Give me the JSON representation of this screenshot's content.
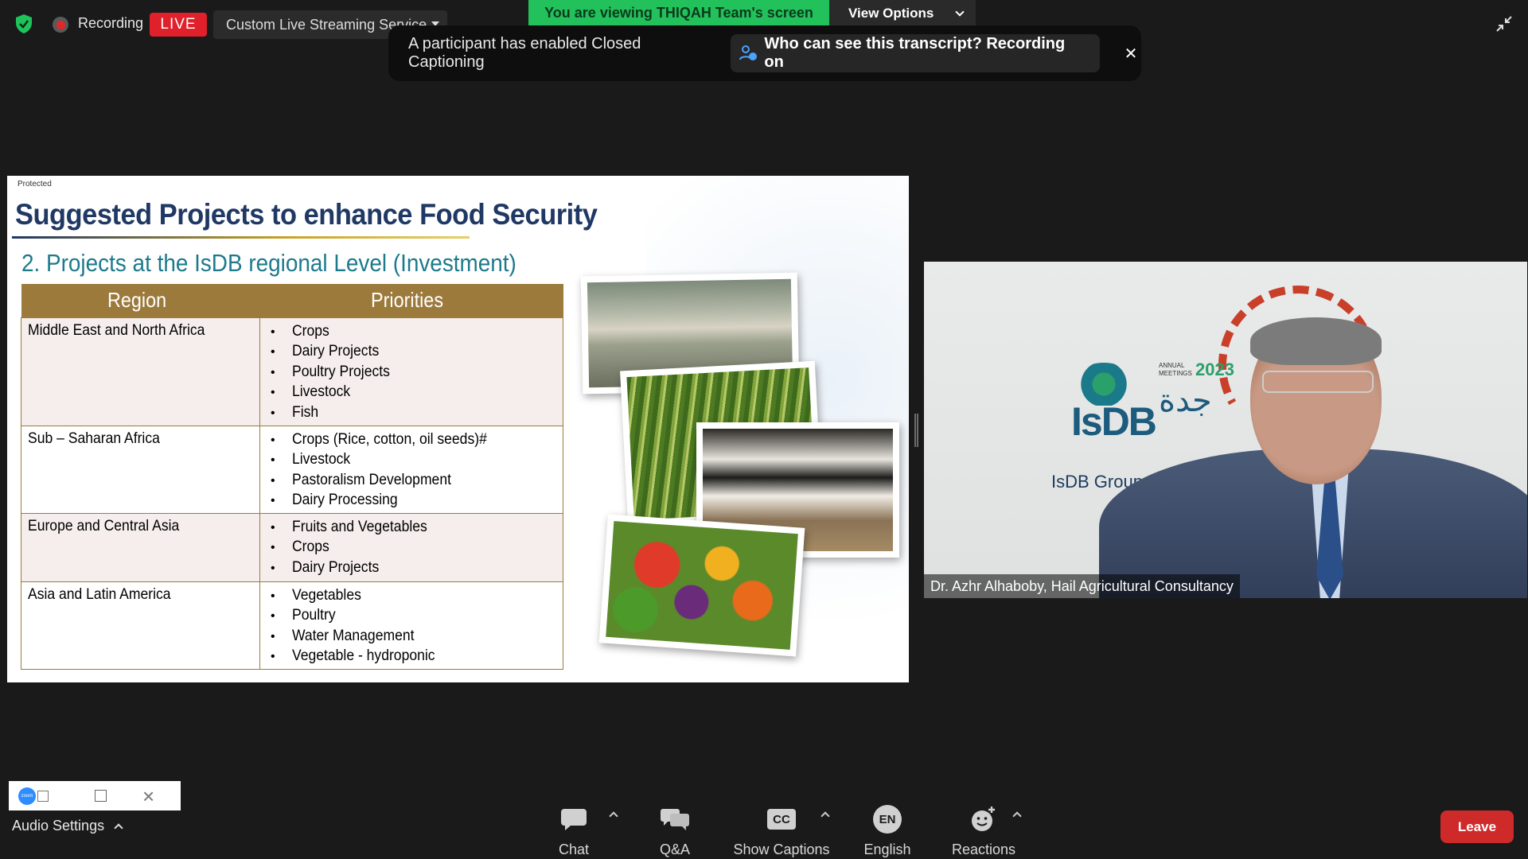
{
  "top_bar": {
    "recording_label": "Recording",
    "live_badge": "LIVE",
    "stream_service": "Custom Live Streaming Service",
    "viewing_banner": "You are viewing THIQAH Team's screen",
    "view_options": "View Options"
  },
  "caption_toast": {
    "message": "A participant has enabled Closed Captioning",
    "info": "Who can see this transcript? Recording on",
    "close_symbol": "✕"
  },
  "slide": {
    "protected_label": "Protected",
    "title": "Suggested Projects to enhance Food Security",
    "subtitle": "2. Projects at the IsDB regional Level (Investment)",
    "table": {
      "headers": [
        "Region",
        "Priorities"
      ],
      "rows": [
        {
          "region": "Middle East and North Africa",
          "priorities": [
            "Crops",
            "Dairy Projects",
            "Poultry Projects",
            "Livestock",
            "Fish"
          ]
        },
        {
          "region": "Sub – Saharan Africa",
          "priorities": [
            "Crops (Rice, cotton, oil seeds)#",
            "Livestock",
            "Pastoralism Development",
            "Dairy Processing"
          ]
        },
        {
          "region": "Europe and Central Asia",
          "priorities": [
            "Fruits and Vegetables",
            "Crops",
            "Dairy Projects"
          ]
        },
        {
          "region": "Asia and Latin America",
          "priorities": [
            "Vegetables",
            "Poultry",
            "Water Management",
            "Vegetable - hydroponic"
          ]
        }
      ]
    }
  },
  "speaker": {
    "name_tag": "Dr. Azhr Alhaboby, Hail Agricultural Consultancy",
    "logo_text": "IsDB",
    "annual_line1": "ANNUAL",
    "annual_line2": "MEETINGS",
    "event_year": "2023",
    "host_city_arabic": "جدة",
    "backdrop_text": "IsDB Group Annual Meetings 2023"
  },
  "mini_window": {
    "zoom_label": "zoom"
  },
  "audio_settings": "Audio Settings",
  "toolbar": {
    "chat": "Chat",
    "qa": "Q&A",
    "captions": "Show Captions",
    "captions_icon": "CC",
    "language": "English",
    "language_icon": "EN",
    "reactions": "Reactions",
    "leave": "Leave"
  },
  "colors": {
    "live_red": "#e0202a",
    "banner_green": "#23c15b",
    "leave_red": "#cf2a2a",
    "table_header_gold": "#9c7a3c",
    "title_navy": "#1f3864"
  }
}
